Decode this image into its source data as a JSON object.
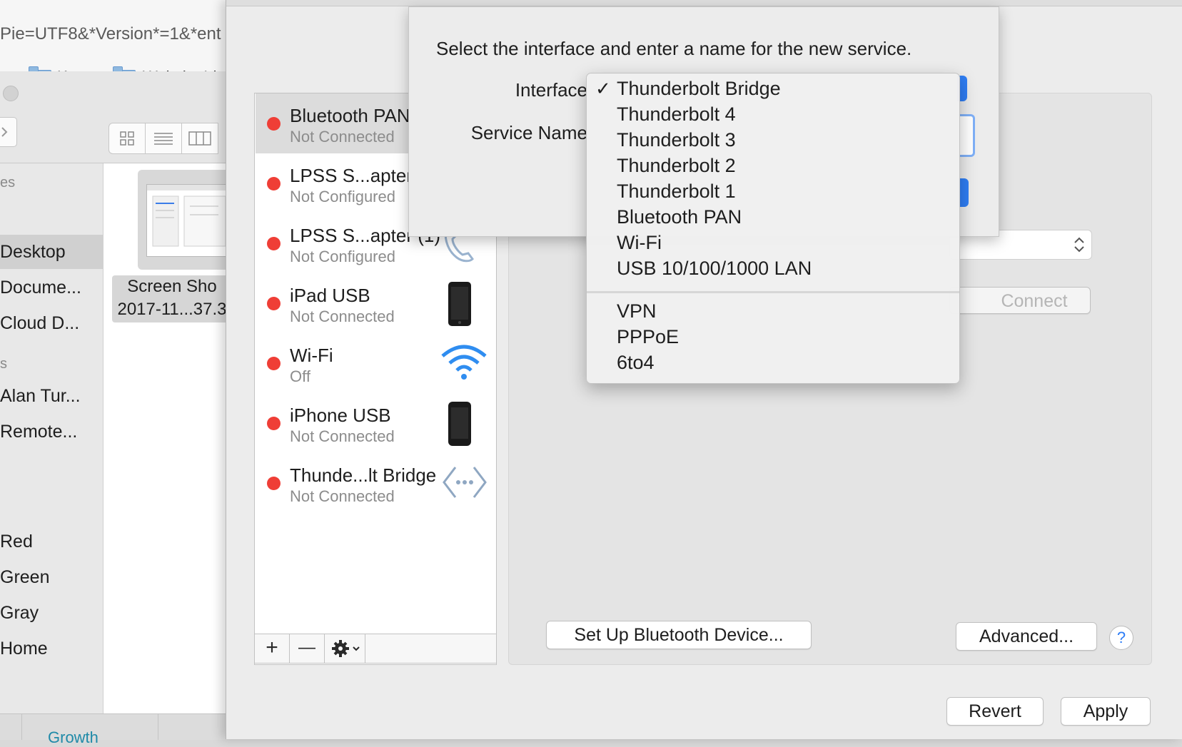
{
  "finder": {
    "url_fragment": "Pie=UTF8&*Version*=1&*ent",
    "bookmarks": [
      {
        "label": "ent",
        "has_folder": false
      },
      {
        "label": "Korea",
        "has_folder": true
      },
      {
        "label": "Website Ide",
        "has_folder": true
      }
    ],
    "sidebar": {
      "section_favorites": "es",
      "favorites": [
        "Desktop",
        "Docume...",
        "Cloud D..."
      ],
      "section_shared": "s",
      "shared": [
        "Alan Tur...",
        "Remote..."
      ],
      "tags": [
        "Red",
        "Green",
        "Gray",
        "Home"
      ],
      "selected": "Desktop"
    },
    "file": {
      "line1": "Screen Sho",
      "line2": "2017-11...37.3"
    },
    "statusbar_text": "Growth"
  },
  "services": [
    {
      "name": "Bluetooth PAN",
      "status": "Not Connected",
      "icon": "bluetooth-icon",
      "selected": true
    },
    {
      "name": "LPSS S...apter",
      "status": "Not Configured",
      "icon": "serial-port-icon",
      "selected": false
    },
    {
      "name": "LPSS S...apter (1)",
      "status": "Not Configured",
      "icon": "phone-handset-icon",
      "selected": false
    },
    {
      "name": "iPad USB",
      "status": "Not Connected",
      "icon": "ipad-icon",
      "selected": false
    },
    {
      "name": "Wi-Fi",
      "status": "Off",
      "icon": "wifi-icon",
      "selected": false
    },
    {
      "name": "iPhone USB",
      "status": "Not Connected",
      "icon": "iphone-icon",
      "selected": false
    },
    {
      "name": "Thunde...lt Bridge",
      "status": "Not Connected",
      "icon": "thunderbolt-bridge-icon",
      "selected": false
    }
  ],
  "list_toolbar": {
    "add": "+",
    "remove": "—"
  },
  "detail": {
    "connect_button": "Connect",
    "setup_bluetooth_button": "Set Up Bluetooth Device...",
    "advanced_button": "Advanced...",
    "help": "?"
  },
  "footer": {
    "revert": "Revert",
    "apply": "Apply"
  },
  "sheet": {
    "title": "Select the interface and enter a name for the new service.",
    "interface_label": "Interface",
    "service_name_label": "Service Name"
  },
  "interface_menu": {
    "selected": "Thunderbolt Bridge",
    "check": "✓",
    "group1": [
      "Thunderbolt Bridge",
      "Thunderbolt 4",
      "Thunderbolt 3",
      "Thunderbolt 2",
      "Thunderbolt 1",
      "Bluetooth PAN",
      "Wi-Fi",
      "USB 10/100/1000 LAN"
    ],
    "group2": [
      "VPN",
      "PPPoE",
      "6to4"
    ]
  },
  "colors": {
    "status_red": "#ef3e36",
    "accent_blue": "#2f7ef5",
    "folder_blue": "#8fb9e0"
  }
}
